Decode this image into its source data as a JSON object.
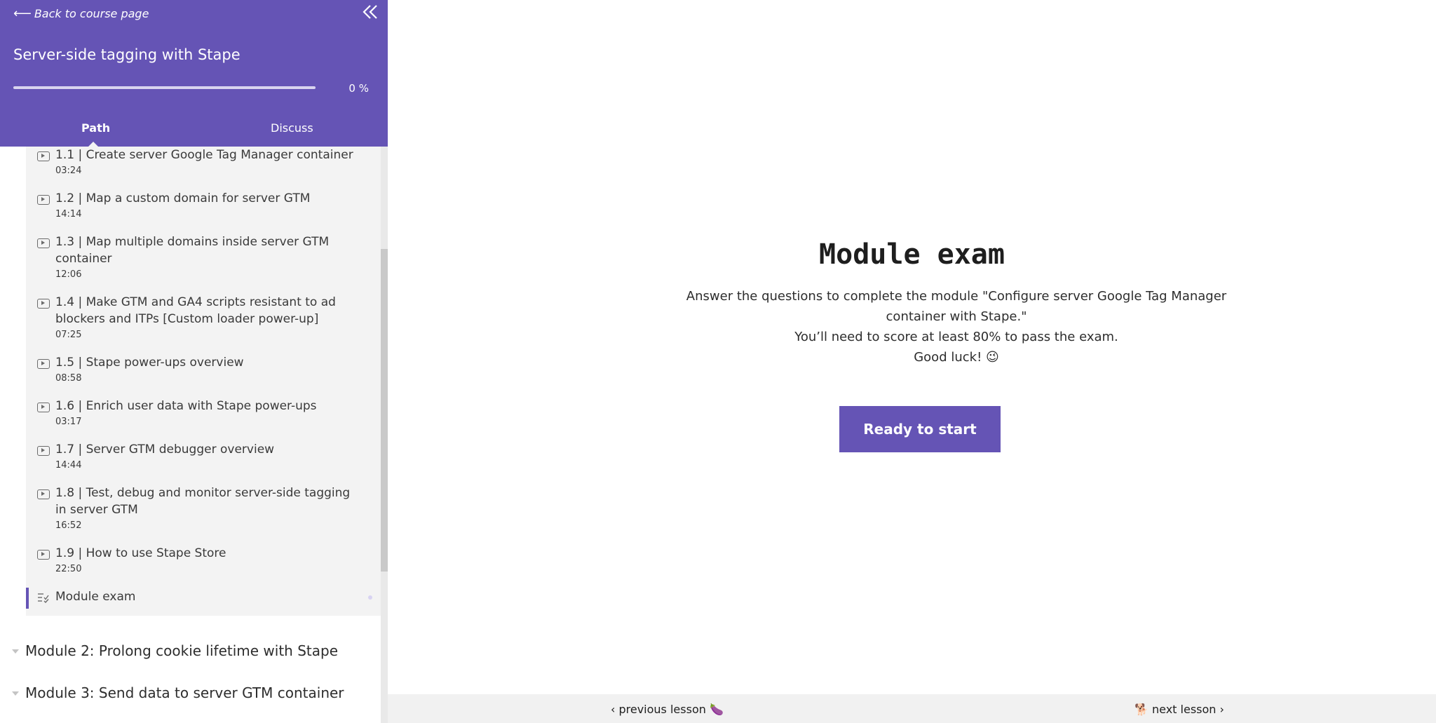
{
  "sidebar": {
    "back_arrow": "⟵",
    "back_label": "Back to course page",
    "course_title": "Server-side tagging with Stape",
    "progress_fraction": 0,
    "progress_text": "0 %",
    "tabs": [
      {
        "label": "Path"
      },
      {
        "label": "Discuss"
      }
    ],
    "lessons": [
      {
        "title": "1.1 | Create server Google Tag Manager container",
        "duration": "03:24"
      },
      {
        "title": "1.2 | Map a custom domain for server GTM",
        "duration": "14:14"
      },
      {
        "title": "1.3 | Map multiple domains inside server GTM container",
        "duration": "12:06"
      },
      {
        "title": "1.4 | Make GTM and GA4 scripts resistant to ad blockers and ITPs [Custom loader power-up]",
        "duration": "07:25"
      },
      {
        "title": "1.5 | Stape power-ups overview",
        "duration": "08:58"
      },
      {
        "title": "1.6 | Enrich user data with Stape power-ups",
        "duration": "03:17"
      },
      {
        "title": "1.7 | Server GTM debugger overview",
        "duration": "14:44"
      },
      {
        "title": "1.8 | Test, debug and monitor server-side tagging in server GTM",
        "duration": "16:52"
      },
      {
        "title": "1.9 | How to use Stape Store",
        "duration": "22:50"
      }
    ],
    "exam_item": "Module exam",
    "modules": [
      {
        "title": "Module 2: Prolong cookie lifetime with Stape"
      },
      {
        "title": "Module 3: Send data to server GTM container"
      }
    ]
  },
  "main": {
    "heading": "Module exam",
    "desc_line1": "Answer the questions to complete the module \"Configure server Google Tag Manager container with Stape.\"",
    "desc_line2": "You’ll need to score at least 80% to pass the exam.",
    "desc_line3": "Good luck! 😉",
    "start_button": "Ready to start"
  },
  "footer": {
    "prev_label": "‹ previous lesson 🍆",
    "next_label": "🐕 next lesson ›"
  },
  "colors": {
    "accent": "#6554b5",
    "panel": "#f3f3f3"
  }
}
